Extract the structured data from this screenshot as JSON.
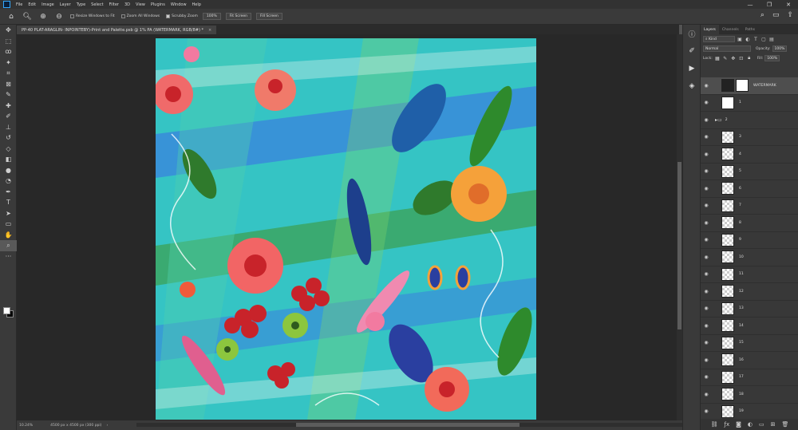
{
  "menubar": {
    "items": [
      "File",
      "Edit",
      "Image",
      "Layer",
      "Type",
      "Select",
      "Filter",
      "3D",
      "View",
      "Plugins",
      "Window",
      "Help"
    ],
    "window_buttons": [
      "—",
      "❐",
      "✕"
    ]
  },
  "options": {
    "resize_windows_label": "Resize Windows to Fit",
    "zoom_all_windows_label": "Zoom All Windows",
    "scrubby_zoom_label": "Scrubby Zoom",
    "zoom_percent": "100%",
    "fit_screen_label": "Fit Screen",
    "fill_screen_label": "Fill Screen"
  },
  "document": {
    "tab_title": "PP-40 PLAT-ARAGLIN- INPOINTEBY)-Print and Palette.psb @ 1% PA (WATERMARK, RGB/8#) *",
    "close_glyph": "×"
  },
  "status": {
    "zoom": "10.24%",
    "info": "4500 px x 4500 px (300 ppi)",
    "arrow": "›"
  },
  "tools": [
    "move",
    "marquee",
    "lasso",
    "magic-wand",
    "crop",
    "frame",
    "eyedropper",
    "healing",
    "brush",
    "stamp",
    "history-brush",
    "eraser",
    "gradient",
    "blur",
    "dodge",
    "pen",
    "type",
    "path-select",
    "rectangle",
    "hand",
    "zoom",
    "more"
  ],
  "dock_icons": [
    "info",
    "brush",
    "play",
    "layers"
  ],
  "layers_panel": {
    "tabs": [
      "Layers",
      "Channels",
      "Paths"
    ],
    "kind_label": "Kind",
    "blend_mode": "Normal",
    "opacity_label": "Opacity:",
    "opacity_value": "100%",
    "lock_label": "Lock:",
    "fill_label": "Fill:",
    "fill_value": "100%",
    "layers": [
      {
        "name": "WATERMARK",
        "type": "mask"
      },
      {
        "name": "1",
        "type": "white"
      },
      {
        "name": "2",
        "type": "group"
      },
      {
        "name": "3",
        "type": "transparent"
      },
      {
        "name": "4",
        "type": "transparent"
      },
      {
        "name": "5",
        "type": "transparent"
      },
      {
        "name": "6",
        "type": "transparent"
      },
      {
        "name": "7",
        "type": "transparent"
      },
      {
        "name": "8",
        "type": "transparent"
      },
      {
        "name": "9",
        "type": "transparent"
      },
      {
        "name": "10",
        "type": "transparent"
      },
      {
        "name": "11",
        "type": "transparent"
      },
      {
        "name": "12",
        "type": "transparent"
      },
      {
        "name": "13",
        "type": "transparent"
      },
      {
        "name": "14",
        "type": "transparent"
      },
      {
        "name": "15",
        "type": "transparent"
      },
      {
        "name": "16",
        "type": "transparent"
      },
      {
        "name": "17",
        "type": "transparent"
      },
      {
        "name": "18",
        "type": "transparent"
      },
      {
        "name": "19",
        "type": "transparent"
      }
    ]
  },
  "colors": {
    "app_bg": "#535353",
    "canvas_bg": "#282828",
    "panel_bg": "#383838",
    "accent": "#31a8ff",
    "art_teal": "#35c4c4",
    "art_blue": "#3b7fe0",
    "art_green": "#3d9a3a",
    "art_pink": "#f06a6a",
    "art_red": "#c8232a",
    "art_orange": "#f5a13a"
  }
}
